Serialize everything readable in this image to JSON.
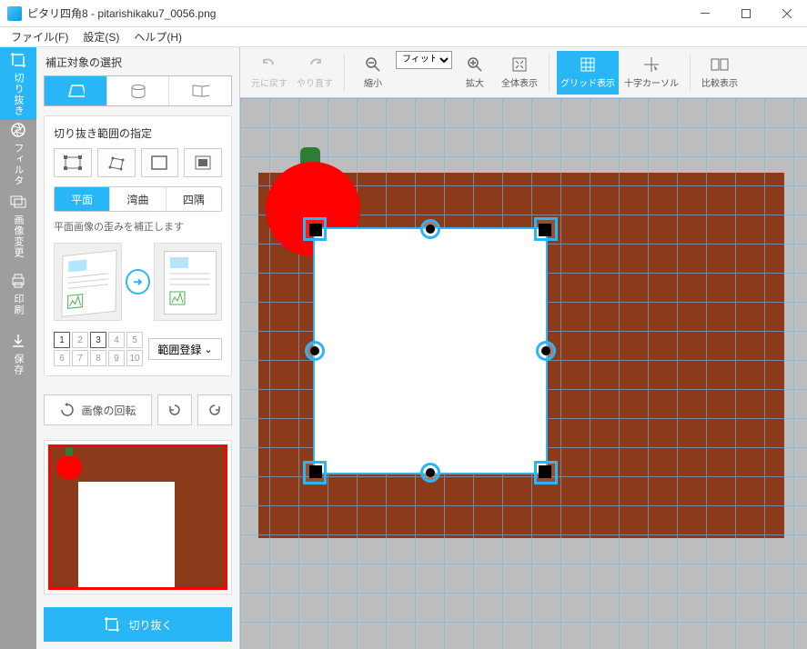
{
  "window": {
    "title": "ピタリ四角8 - pitarishikaku7_0056.png"
  },
  "menu": {
    "file": "ファイル(F)",
    "settings": "設定(S)",
    "help": "ヘルプ(H)"
  },
  "rail": {
    "crop": "切り抜き",
    "filter": "フィルタ",
    "change": "画像変更",
    "print": "印刷",
    "save": "保存"
  },
  "panel": {
    "select_target": "補正対象の選択",
    "crop_range_title": "切り抜き範囲の指定",
    "seg_flat": "平面",
    "seg_curve": "湾曲",
    "seg_corner": "四隅",
    "flat_desc": "平面画像の歪みを補正します",
    "range_register": "範囲登録",
    "numbers": {
      "n1": "1",
      "n2": "2",
      "n3": "3",
      "n4": "4",
      "n5": "5",
      "n6": "6",
      "n7": "7",
      "n8": "8",
      "n9": "9",
      "n10": "10"
    },
    "rotate_label": "画像の回転",
    "crop_action": "切り抜く"
  },
  "toolbar": {
    "undo": "元に戻す",
    "redo": "やり直す",
    "zoom_out": "縮小",
    "fit_option": "フィット",
    "zoom_in": "拡大",
    "fit_all": "全体表示",
    "grid": "グリッド表示",
    "crosshair": "十字カーソル",
    "compare": "比較表示"
  }
}
